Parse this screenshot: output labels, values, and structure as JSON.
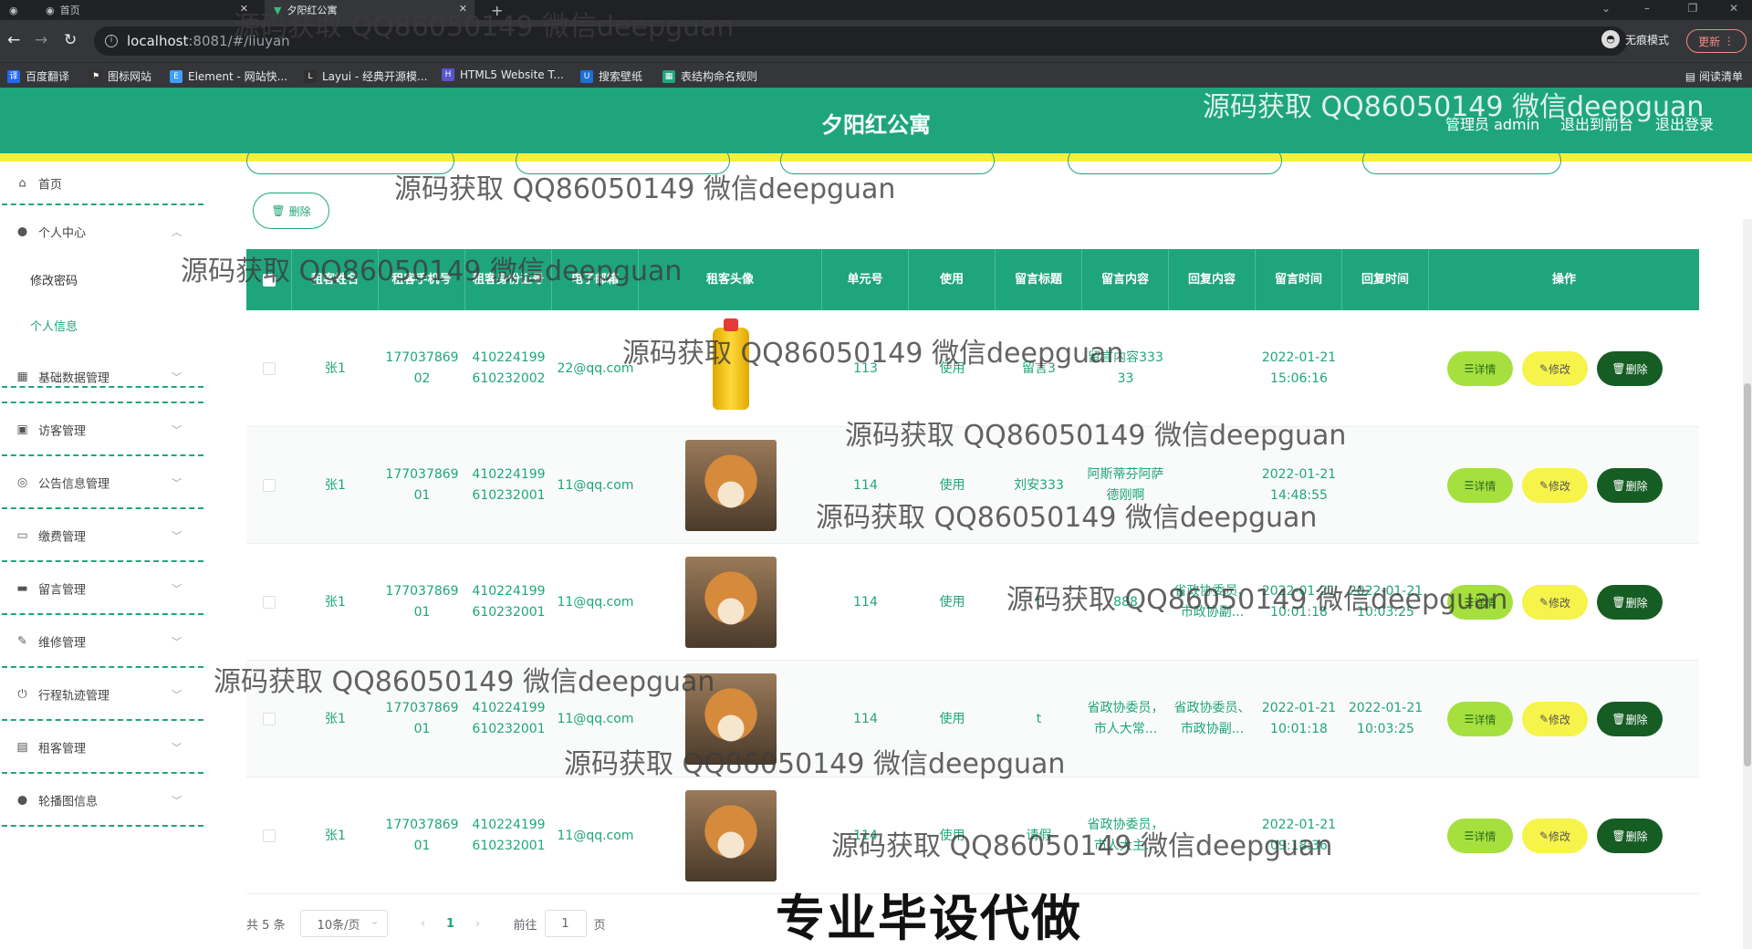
{
  "browser": {
    "tabs": [
      {
        "title": "首页"
      },
      {
        "title": "夕阳红公寓"
      }
    ],
    "url": "localhost:8081/#/liuyan",
    "url_host": "localhost",
    "url_rest": ":8081/#/liuyan",
    "incognito_label": "无痕模式",
    "update_label": "更新",
    "reading_list_label": "阅读清单",
    "bookmarks": [
      {
        "label": "百度翻译",
        "color": "#2468f2"
      },
      {
        "label": "图标网站",
        "color": "#333333"
      },
      {
        "label": "Element - 网站快...",
        "color": "#409eff"
      },
      {
        "label": "Layui - 经典开源模...",
        "color": "#2f2f2f"
      },
      {
        "label": "HTML5 Website T...",
        "color": "#5a55c9"
      },
      {
        "label": "搜索壁纸",
        "color": "#1e6fd9"
      },
      {
        "label": "表结构命名规则",
        "color": "#1fa57b"
      }
    ]
  },
  "header": {
    "title": "夕阳红公寓",
    "user_label": "管理员 admin",
    "back_label": "退出到前台",
    "logout_label": "退出登录"
  },
  "sidebar": {
    "home": "首页",
    "personal_center": "个人中心",
    "change_password": "修改密码",
    "personal_info": "个人信息",
    "items": [
      {
        "label": "基础数据管理",
        "icon": "grid-icon"
      },
      {
        "label": "访客管理",
        "icon": "id-card-icon"
      },
      {
        "label": "公告信息管理",
        "icon": "compass-icon"
      },
      {
        "label": "缴费管理",
        "icon": "message-icon"
      },
      {
        "label": "留言管理",
        "icon": "printer-icon"
      },
      {
        "label": "维修管理",
        "icon": "edit-icon"
      },
      {
        "label": "行程轨迹管理",
        "icon": "power-icon"
      },
      {
        "label": "租客管理",
        "icon": "clipboard-icon"
      },
      {
        "label": "轮播图信息",
        "icon": "user-icon"
      }
    ]
  },
  "toolbar": {
    "delete_label": "删除"
  },
  "table": {
    "headers": [
      "租客姓名",
      "租客手机号",
      "租客身份证号",
      "电子邮箱",
      "租客头像",
      "单元号",
      "使用",
      "留言标题",
      "留言内容",
      "回复内容",
      "留言时间",
      "回复时间",
      "操作"
    ],
    "rows": [
      {
        "name": "张1",
        "phone": "17703786902",
        "id_no": "410224199610232002",
        "email": "22@qq.com",
        "avatar": "bottle",
        "unit": "113",
        "use": "使用",
        "title": "留言3",
        "content": "留言内容33333",
        "reply": "",
        "msg_time": "2022-01-21 15:06:16",
        "reply_time": ""
      },
      {
        "name": "张1",
        "phone": "17703786901",
        "id_no": "410224199610232001",
        "email": "11@qq.com",
        "avatar": "dog",
        "unit": "114",
        "use": "使用",
        "title": "刘安333",
        "content": "阿斯蒂芬阿萨德刚啊",
        "reply": "",
        "msg_time": "2022-01-21 14:48:55",
        "reply_time": ""
      },
      {
        "name": "张1",
        "phone": "17703786901",
        "id_no": "410224199610232001",
        "email": "11@qq.com",
        "avatar": "dog",
        "unit": "114",
        "use": "使用",
        "title": "t",
        "content": "888",
        "reply": "省政协委员、市政协副...",
        "msg_time": "2022-01-21 10:01:18",
        "reply_time": "2022-01-21 10:03:25"
      },
      {
        "name": "张1",
        "phone": "17703786901",
        "id_no": "410224199610232001",
        "email": "11@qq.com",
        "avatar": "dog",
        "unit": "114",
        "use": "使用",
        "title": "t",
        "content": "省政协委员，市人大常...",
        "reply": "省政协委员、市政协副...",
        "msg_time": "2022-01-21 10:01:18",
        "reply_time": "2022-01-21 10:03:25"
      },
      {
        "name": "张1",
        "phone": "17703786901",
        "id_no": "410224199610232001",
        "email": "11@qq.com",
        "avatar": "dog",
        "unit": "114",
        "use": "使用",
        "title": "请假",
        "content": "省政协委员，市人大主...",
        "reply": "",
        "msg_time": "2022-01-21 09:18:36",
        "reply_time": ""
      }
    ],
    "action_detail": "详情",
    "action_edit": "修改",
    "action_delete": "删除"
  },
  "pagination": {
    "total": "共 5 条",
    "page_size": "10条/页",
    "prev": "‹",
    "current": "1",
    "next": "›",
    "goto_label": "前往",
    "goto_value": "1",
    "page_suffix": "页"
  },
  "watermarks": [
    "源码获取 QQ86050149 微信deepguan"
  ],
  "banner": "专业毕设代做",
  "colors": {
    "primary": "#1fa57b",
    "accent_yellow": "#f4ef3a",
    "detail": "#a5e03f",
    "edit": "#f6f34a",
    "delete": "#165d24"
  }
}
